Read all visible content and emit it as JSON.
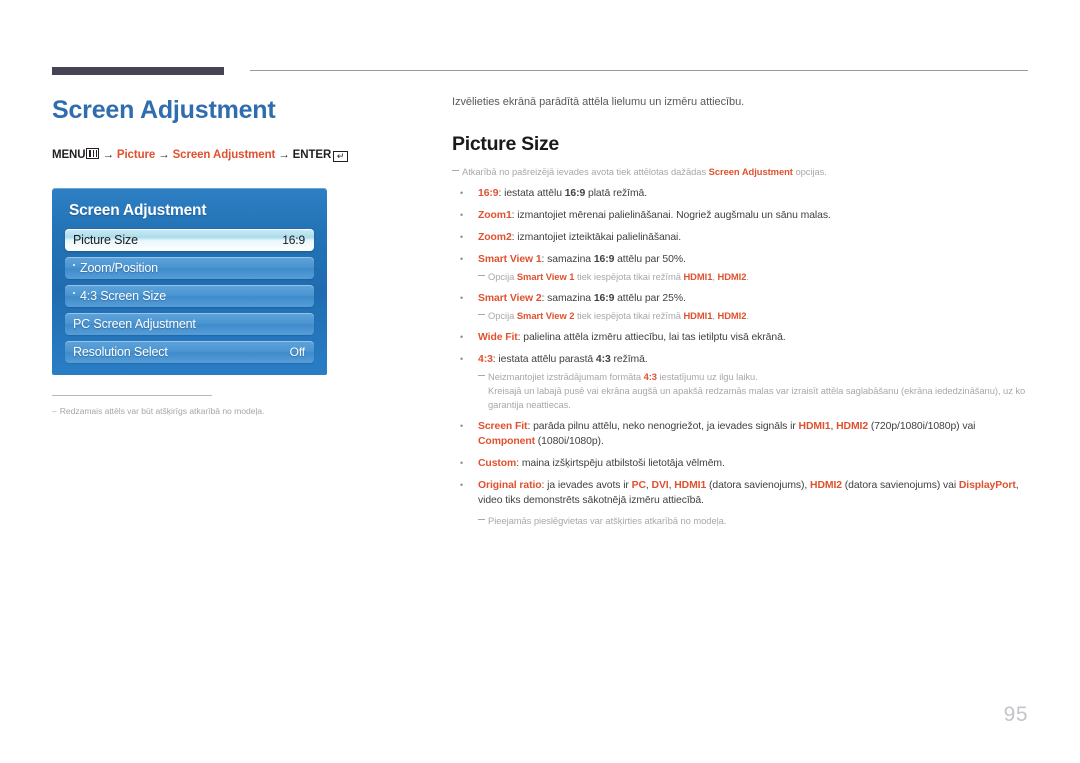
{
  "header": {
    "rule_bar": "dark-bar",
    "rule_line": "thin-line"
  },
  "left": {
    "page_title": "Screen Adjustment",
    "menu_path": {
      "menu_label": "MENU",
      "menu_icon": "menu-grid-icon",
      "arrow1": "→",
      "item1": "Picture",
      "arrow2": "→",
      "item2": "Screen Adjustment",
      "arrow3": "→",
      "enter_label": "ENTER",
      "enter_icon": "↵"
    },
    "osd": {
      "title": "Screen Adjustment",
      "rows": [
        {
          "label": "Picture Size",
          "value": "16:9",
          "selected": true,
          "sub": false
        },
        {
          "label": "Zoom/Position",
          "value": "",
          "selected": false,
          "sub": true
        },
        {
          "label": "4:3 Screen Size",
          "value": "",
          "selected": false,
          "sub": true
        },
        {
          "label": "PC Screen Adjustment",
          "value": "",
          "selected": false,
          "sub": false
        },
        {
          "label": "Resolution Select",
          "value": "Off",
          "selected": false,
          "sub": false
        }
      ]
    },
    "footnote": {
      "dash": "–",
      "text": "Redzamais attēls var būt atšķirīgs atkarībā no modeļa."
    }
  },
  "right": {
    "intro": "Izvēlieties ekrānā parādītā attēla lielumu un izmēru attiecību.",
    "section_title": "Picture Size",
    "lead_note": {
      "pre": "Atkarībā no pašreizējā ievades avota tiek attēlotas dažādas ",
      "accent": "Screen Adjustment",
      "post": " opcijas."
    },
    "bullets": [
      {
        "term": "16:9",
        "parts": [
          {
            "t": ": iestata attēlu ",
            "s": "plain"
          },
          {
            "t": "16:9",
            "s": "bold"
          },
          {
            "t": " platā režīmā.",
            "s": "plain"
          }
        ]
      },
      {
        "term": "Zoom1",
        "parts": [
          {
            "t": ": izmantojiet mērenai palielināšanai. Nogriež augšmalu un sānu malas.",
            "s": "plain"
          }
        ]
      },
      {
        "term": "Zoom2",
        "parts": [
          {
            "t": ": izmantojiet izteiktākai palielināšanai.",
            "s": "plain"
          }
        ]
      },
      {
        "term": "Smart View 1",
        "parts": [
          {
            "t": ": samazina ",
            "s": "plain"
          },
          {
            "t": "16:9",
            "s": "bold"
          },
          {
            "t": " attēlu par 50%.",
            "s": "plain"
          }
        ],
        "note": {
          "pre": "Opcija ",
          "accent": "Smart View 1",
          "mid": " tiek iespējota tikai režīmā ",
          "accent2": "HDMI1",
          "mid2": ", ",
          "accent3": "HDMI2",
          "post": "."
        }
      },
      {
        "term": "Smart View 2",
        "parts": [
          {
            "t": ": samazina ",
            "s": "plain"
          },
          {
            "t": "16:9",
            "s": "bold"
          },
          {
            "t": " attēlu par 25%.",
            "s": "plain"
          }
        ],
        "note": {
          "pre": "Opcija ",
          "accent": "Smart View 2",
          "mid": " tiek iespējota tikai režīmā ",
          "accent2": "HDMI1",
          "mid2": ", ",
          "accent3": "HDMI2",
          "post": "."
        }
      },
      {
        "term": "Wide Fit",
        "parts": [
          {
            "t": ": palielina attēla izmēru attiecību, lai tas ietilptu visā ekrānā.",
            "s": "plain"
          }
        ]
      },
      {
        "term": "4:3",
        "parts": [
          {
            "t": ": iestata attēlu parastā ",
            "s": "plain"
          },
          {
            "t": "4:3",
            "s": "bold"
          },
          {
            "t": " režīmā.",
            "s": "plain"
          }
        ],
        "note": {
          "pre": "Neizmantojiet izstrādājumam formāta ",
          "accent": "4:3",
          "mid": " iestatījumu uz ilgu laiku.",
          "cont": "Kreisajā un labajā pusē vai ekrāna augšā un apakšā redzamās malas var izraisīt attēla saglabāšanu (ekrāna iededzināšanu), uz ko garantija neattiecas."
        }
      },
      {
        "term": "Screen Fit",
        "parts": [
          {
            "t": ": parāda pilnu attēlu, neko nenogriežot, ja ievades signāls ir ",
            "s": "plain"
          },
          {
            "t": "HDMI1",
            "s": "accent"
          },
          {
            "t": ", ",
            "s": "plain"
          },
          {
            "t": "HDMI2",
            "s": "accent"
          },
          {
            "t": " (720p/1080i/1080p) vai ",
            "s": "plain"
          },
          {
            "t": "Component",
            "s": "accent"
          },
          {
            "t": " (1080i/1080p).",
            "s": "plain"
          }
        ]
      },
      {
        "term": "Custom",
        "parts": [
          {
            "t": ": maina izšķirtspēju atbilstoši lietotāja vēlmēm.",
            "s": "plain"
          }
        ]
      },
      {
        "term": "Original ratio",
        "parts": [
          {
            "t": ": ja ievades avots ir ",
            "s": "plain"
          },
          {
            "t": "PC",
            "s": "accent"
          },
          {
            "t": ", ",
            "s": "plain"
          },
          {
            "t": "DVI",
            "s": "accent"
          },
          {
            "t": ", ",
            "s": "plain"
          },
          {
            "t": "HDMI1",
            "s": "accent"
          },
          {
            "t": " (datora savienojums), ",
            "s": "plain"
          },
          {
            "t": "HDMI2",
            "s": "accent"
          },
          {
            "t": " (datora savienojums) vai ",
            "s": "plain"
          },
          {
            "t": "DisplayPort",
            "s": "accent"
          },
          {
            "t": ", video tiks demonstrēts sākotnējā izmēru attiecībā.",
            "s": "plain"
          }
        ]
      }
    ],
    "final_note": "Pieejamās pieslēgvietas var atšķirties atkarībā no modeļa."
  },
  "page_number": "95",
  "colors": {
    "accent_orange": "#e0512f",
    "title_blue": "#2f6daf",
    "osd_blue": "#2373b7",
    "note_gray": "#a8a8ad",
    "body_gray": "#414042",
    "header_bar": "#454354"
  }
}
